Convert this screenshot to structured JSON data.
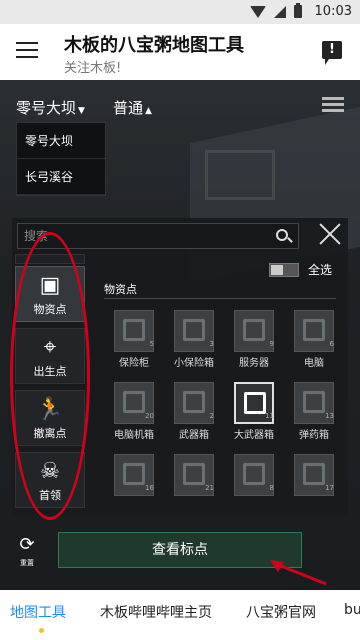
{
  "status_bar": {
    "time": "10:03"
  },
  "app_bar": {
    "title": "木板的八宝粥地图工具",
    "subtitle": "关注木板!"
  },
  "map_controls": {
    "map_select": "零号大坝",
    "mode_select": "普通",
    "map_options": [
      "零号大坝",
      "长弓溪谷"
    ]
  },
  "search": {
    "placeholder": "搜索"
  },
  "categories": [
    {
      "label": "物资点",
      "icon": "box-icon",
      "glyph": "▣",
      "active": true
    },
    {
      "label": "出生点",
      "icon": "location-pin-icon",
      "glyph": "⌖",
      "active": false
    },
    {
      "label": "撤离点",
      "icon": "running-person-icon",
      "glyph": "🏃",
      "active": false
    },
    {
      "label": "首领",
      "icon": "skull-icon",
      "glyph": "☠",
      "active": false
    }
  ],
  "panel": {
    "select_all_label": "全选",
    "section_title": "物资点"
  },
  "items": [
    {
      "name": "保险柜",
      "count": "5"
    },
    {
      "name": "小保险箱",
      "count": "3"
    },
    {
      "name": "服务器",
      "count": "9"
    },
    {
      "name": "电脑",
      "count": "6"
    },
    {
      "name": "电脑机箱",
      "count": "20"
    },
    {
      "name": "武器箱",
      "count": "2"
    },
    {
      "name": "大武器箱",
      "count": "11"
    },
    {
      "name": "弹药箱",
      "count": "13"
    },
    {
      "name": "",
      "count": "16"
    },
    {
      "name": "",
      "count": "21"
    },
    {
      "name": "",
      "count": "8"
    },
    {
      "name": "",
      "count": "17"
    }
  ],
  "bottom": {
    "refresh_label": "重置",
    "view_markers_label": "查看标点"
  },
  "tabs": [
    "地图工具",
    "木板哔哩哔哩主页",
    "八宝粥官网",
    "bu"
  ],
  "colors": {
    "annotation": "#d0021b",
    "active_tab": "#1a8cff",
    "button_border": "#2e7a55"
  }
}
